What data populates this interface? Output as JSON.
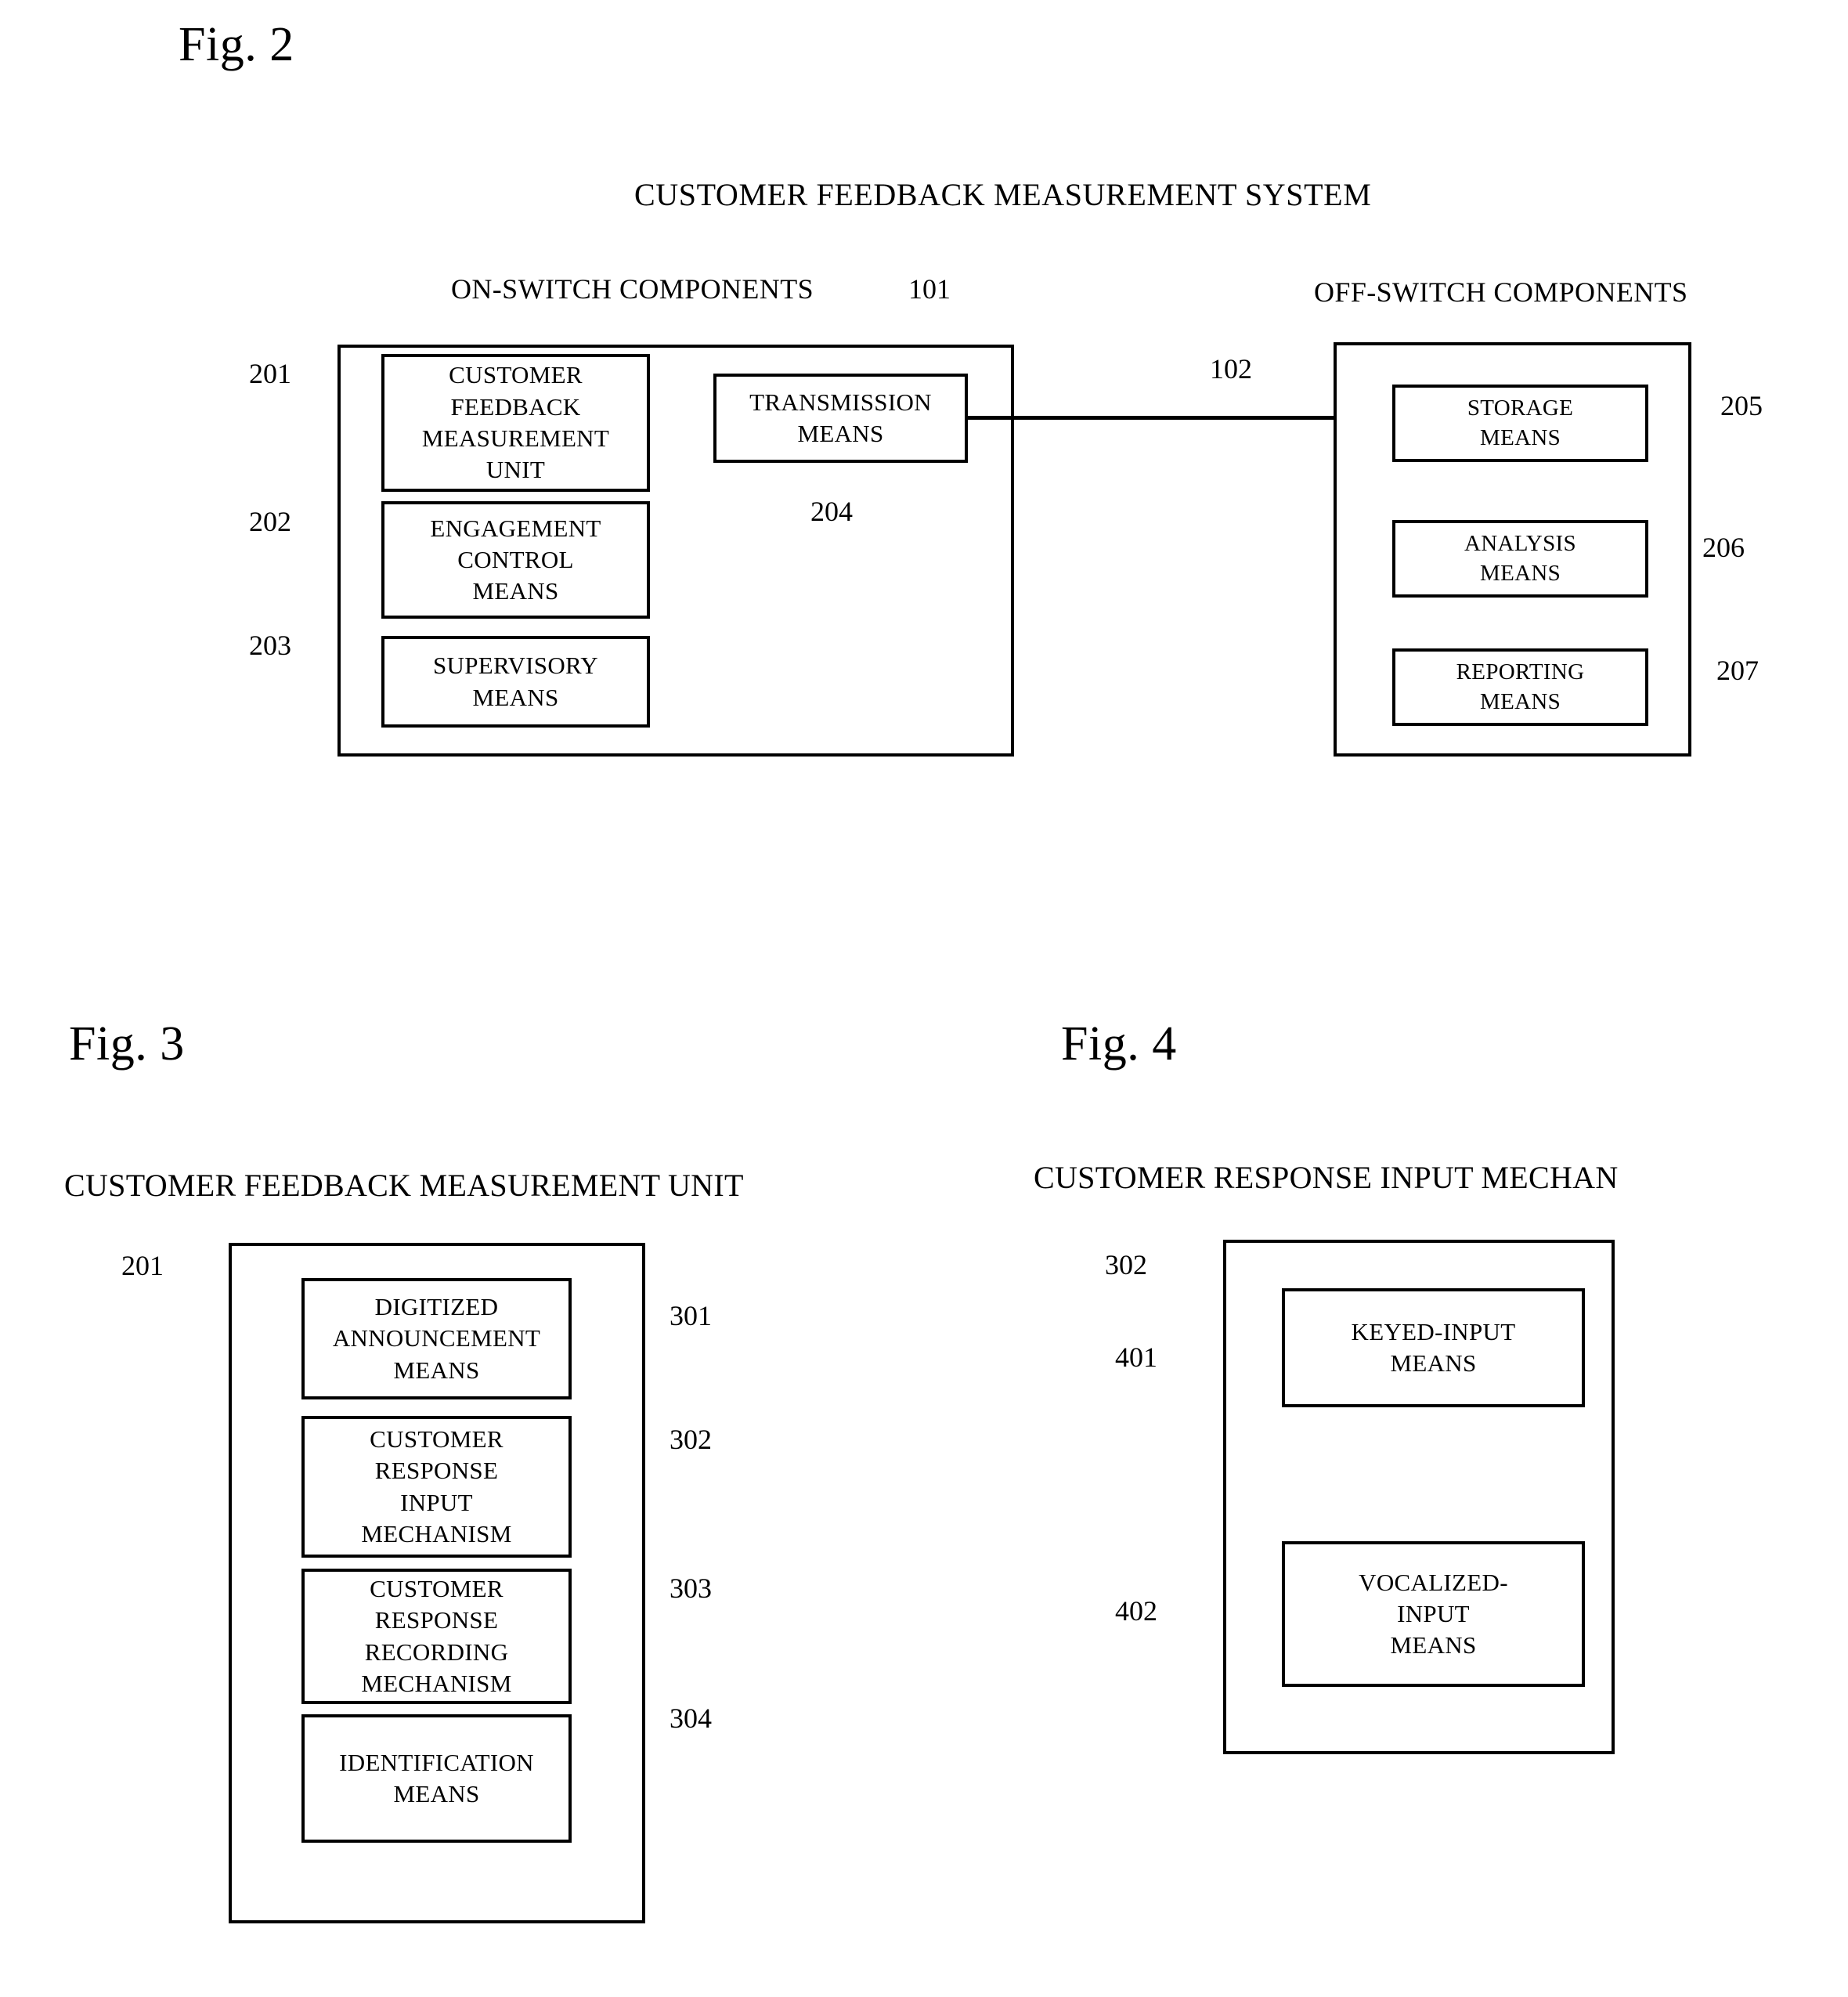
{
  "document": {
    "kind": "patent-drawing-sheet",
    "background_color": "#ffffff",
    "ink_color": "#000000"
  },
  "fig2": {
    "figure_label": "Fig. 2",
    "system_title": "CUSTOMER FEEDBACK MEASUREMENT SYSTEM",
    "left_group": {
      "header": "ON-SWITCH COMPONENTS",
      "ref": "101",
      "blocks": [
        {
          "ref": "201",
          "label": "CUSTOMER\nFEEDBACK\nMEASUREMENT\nUNIT"
        },
        {
          "ref": "202",
          "label": "ENGAGEMENT\nCONTROL\nMEANS"
        },
        {
          "ref": "203",
          "label": "SUPERVISORY\nMEANS"
        }
      ],
      "transmission": {
        "ref": "204",
        "label": "TRANSMISSION\nMEANS"
      }
    },
    "link": {
      "ref": "102",
      "direction": "left-to-right"
    },
    "right_group": {
      "header": "OFF-SWITCH COMPONENTS",
      "blocks": [
        {
          "ref": "205",
          "label": "STORAGE\nMEANS"
        },
        {
          "ref": "206",
          "label": "ANALYSIS\nMEANS"
        },
        {
          "ref": "207",
          "label": "REPORTING\nMEANS"
        }
      ]
    }
  },
  "fig3": {
    "figure_label": "Fig. 3",
    "title": "CUSTOMER FEEDBACK MEASUREMENT UNIT",
    "container_ref": "201",
    "blocks": [
      {
        "ref": "301",
        "label": "DIGITIZED\nANNOUNCEMENT\nMEANS"
      },
      {
        "ref": "302",
        "label": "CUSTOMER\nRESPONSE\nINPUT\nMECHANISM"
      },
      {
        "ref": "303",
        "label": "CUSTOMER\nRESPONSE\nRECORDING\nMECHANISM"
      },
      {
        "ref": "304",
        "label": "IDENTIFICATION\nMEANS"
      }
    ]
  },
  "fig4": {
    "figure_label": "Fig. 4",
    "title": "CUSTOMER RESPONSE INPUT MECHAN",
    "container_ref": "302",
    "blocks": [
      {
        "ref": "401",
        "label": "KEYED-INPUT\nMEANS"
      },
      {
        "ref": "402",
        "label": "VOCALIZED-\nINPUT\nMEANS"
      }
    ]
  }
}
